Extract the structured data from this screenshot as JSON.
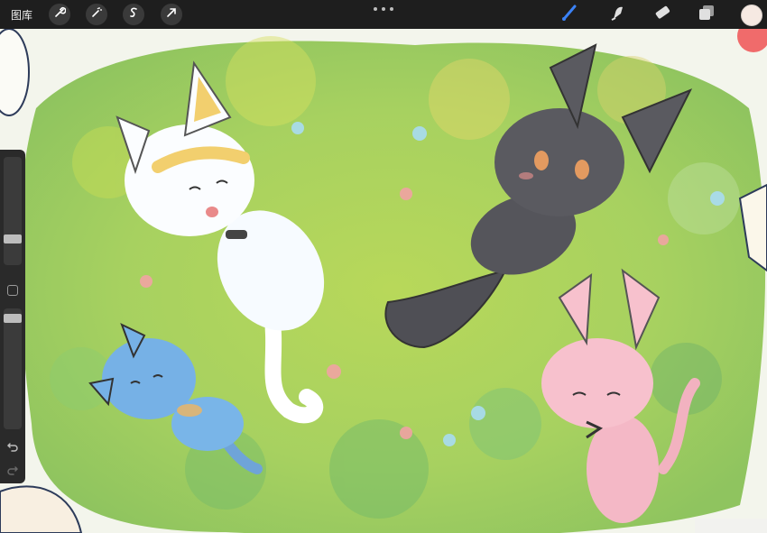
{
  "topbar": {
    "gallery_label": "图库",
    "left_tools": [
      "wrench-icon",
      "magic-wand-icon",
      "selection-s-icon",
      "transform-arrow-icon"
    ],
    "right_tools": [
      "brush-icon",
      "smudge-icon",
      "eraser-icon",
      "layers-icon"
    ],
    "current_color": "#f6e9e2",
    "brush_color": "#3b82f6"
  },
  "sidebar": {
    "brush_size_level": 0.22,
    "opacity_level": 0.05,
    "icons": [
      "modify-square-icon",
      "undo-icon",
      "redo-icon"
    ]
  },
  "artwork": {
    "grass_color": "#9ecb53",
    "characters": [
      "white-cat",
      "black-cat",
      "blue-cat",
      "pink-cat"
    ]
  }
}
